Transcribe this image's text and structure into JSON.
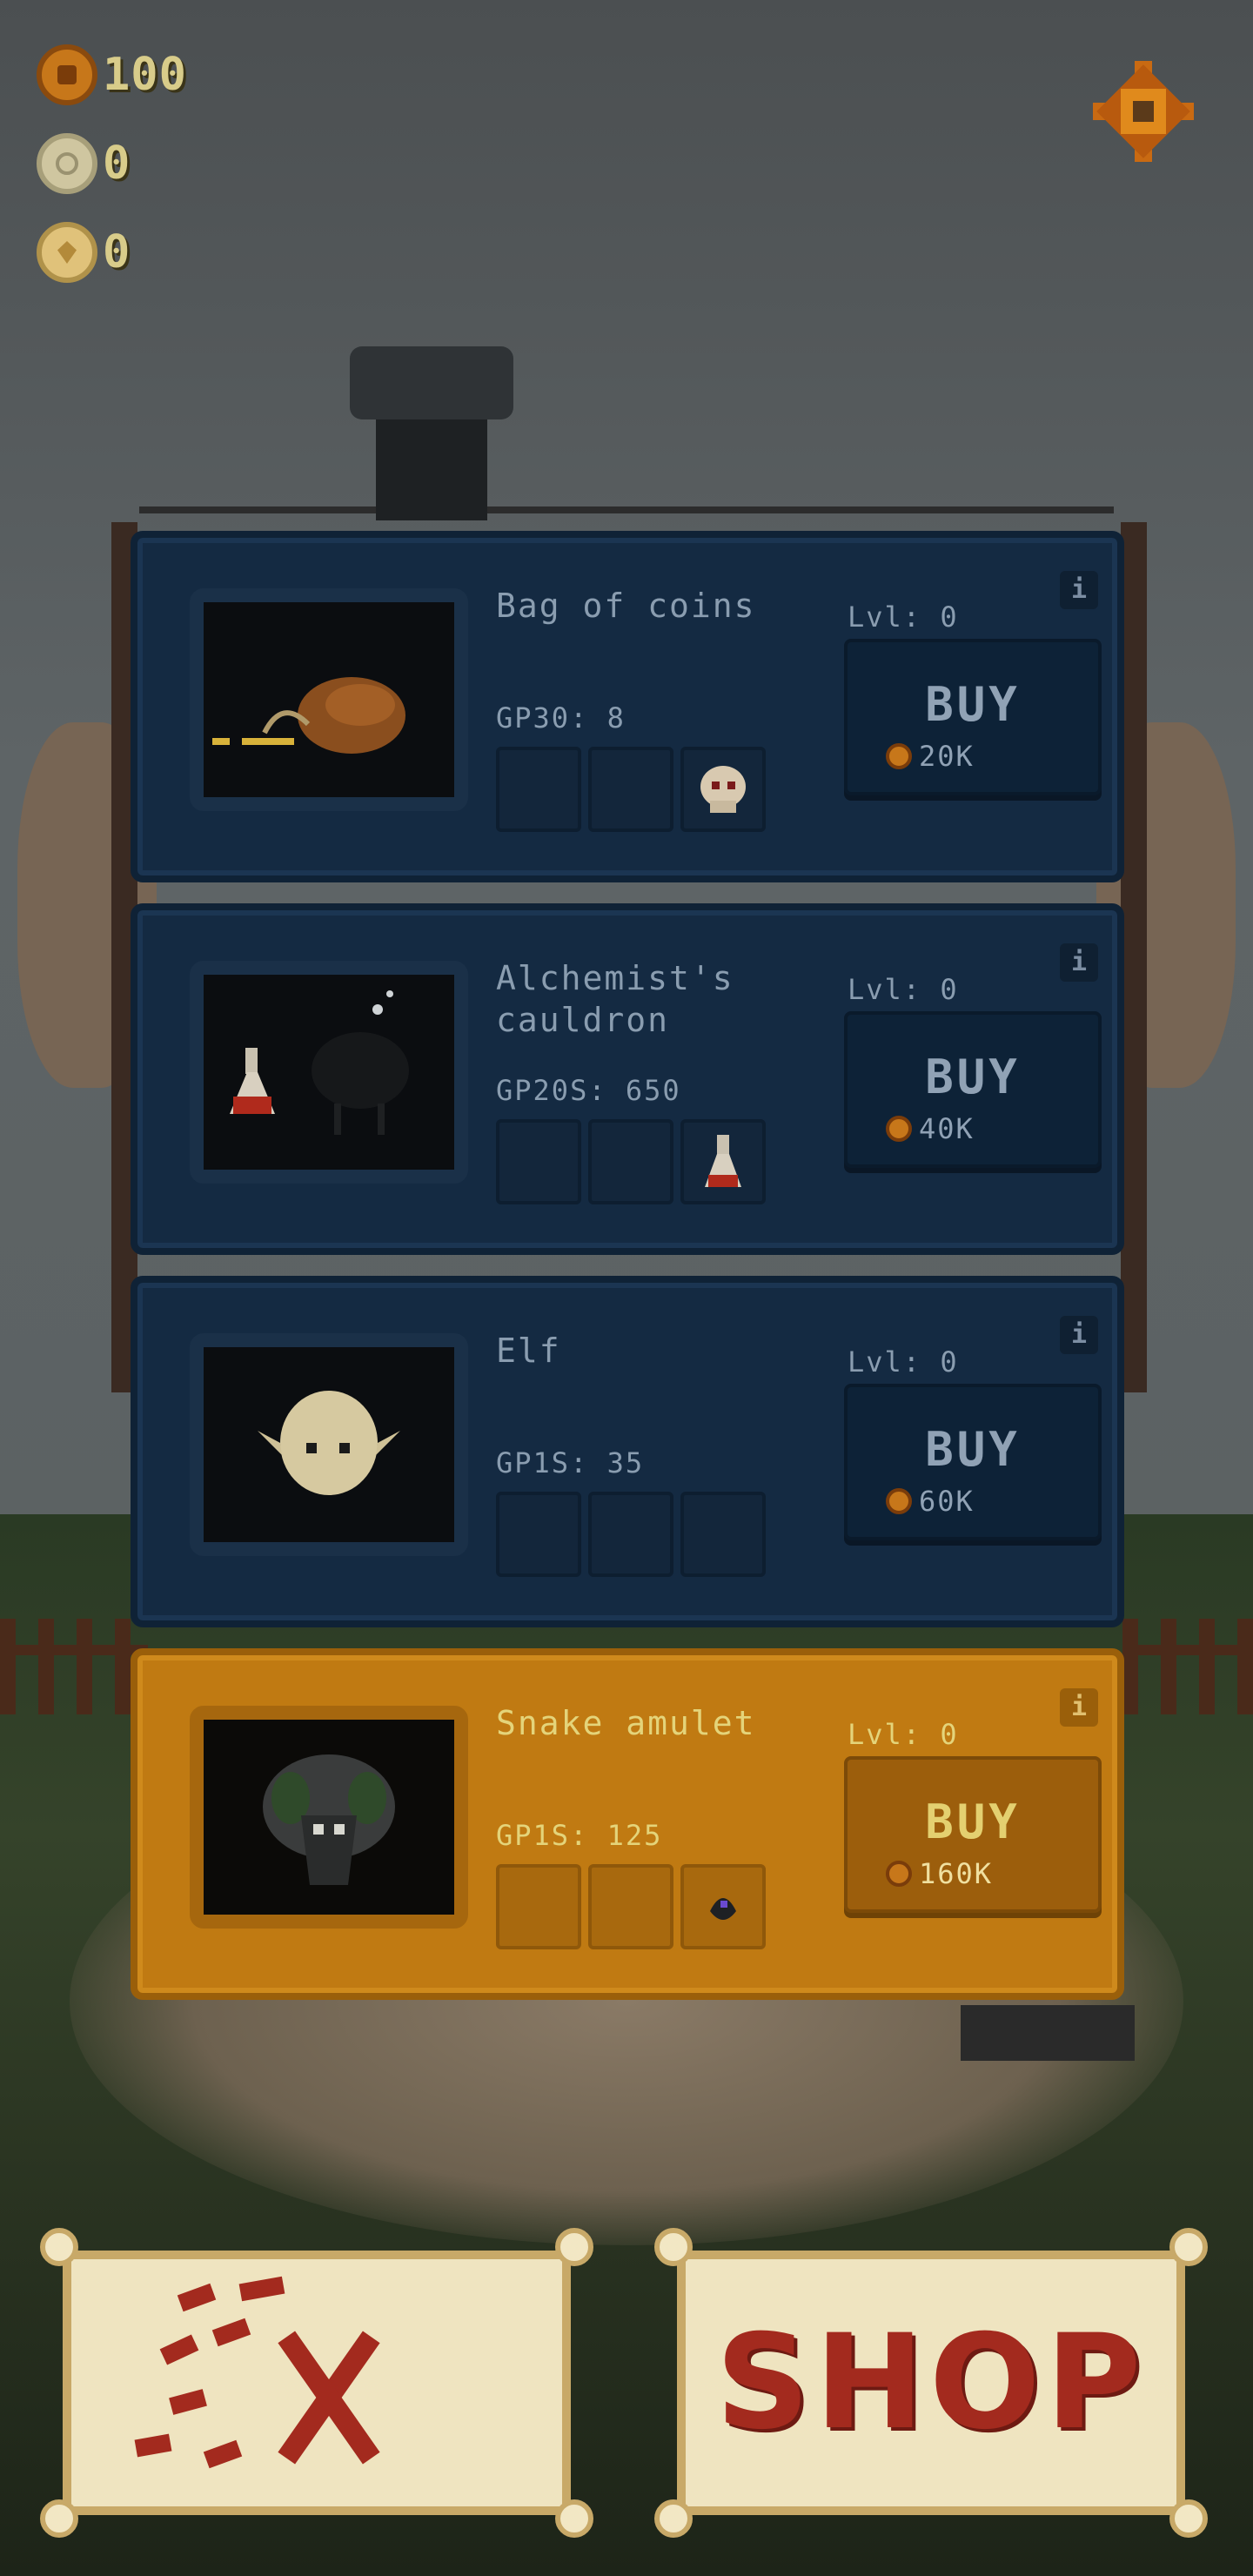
{
  "hud": {
    "currencies": [
      {
        "icon": "gold-coin-icon",
        "value": "100"
      },
      {
        "icon": "silver-coin-icon",
        "value": "0"
      },
      {
        "icon": "gem-coin-icon",
        "value": "0"
      }
    ],
    "settings_icon": "settings-gear-icon"
  },
  "shop_items": [
    {
      "name": "Bag of coins",
      "gp": "GP30: 8",
      "level": "Lvl: 0",
      "buy_label": "BUY",
      "price": "20K",
      "icon": "coin-bag-icon",
      "slot_icon": "skull-icon",
      "highlighted": false
    },
    {
      "name": "Alchemist's cauldron",
      "gp": "GP20S: 650",
      "level": "Lvl: 0",
      "buy_label": "BUY",
      "price": "40K",
      "icon": "cauldron-icon",
      "slot_icon": "flask-icon",
      "highlighted": false
    },
    {
      "name": "Elf",
      "gp": "GP1S: 35",
      "level": "Lvl: 0",
      "buy_label": "BUY",
      "price": "60K",
      "icon": "elf-head-icon",
      "slot_icon": "",
      "highlighted": false
    },
    {
      "name": "Snake amulet",
      "gp": "GP1S: 125",
      "level": "Lvl: 0",
      "buy_label": "BUY",
      "price": "160K",
      "icon": "snake-amulet-icon",
      "slot_icon": "amulet-icon",
      "highlighted": true
    }
  ],
  "info_label": "i",
  "bottom": {
    "map_button_icon": "treasure-map-icon",
    "shop_label": "SHOP"
  },
  "colors": {
    "panel_blue": "#142a42",
    "panel_gold": "#c07a12",
    "text_muted": "#8a9db0",
    "shop_red": "#a32a1e"
  }
}
